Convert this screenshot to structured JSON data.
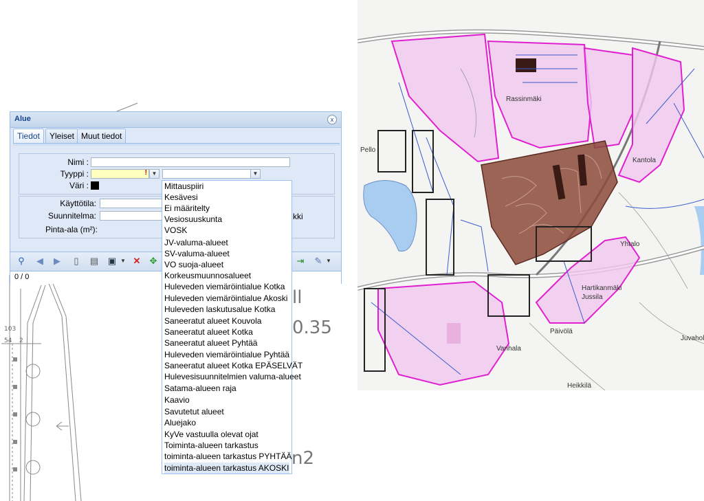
{
  "panel": {
    "title": "Alue",
    "close_glyph": "x",
    "tabs": [
      "Tiedot",
      "Yleiset",
      "Muut tiedot"
    ],
    "active_tab": "Tiedot",
    "fields": {
      "nimi_label": "Nimi :",
      "nimi_value": "",
      "tyyppi_label": "Tyyppi :",
      "tyyppi_value": "",
      "tyyppi_warning": "!",
      "subtype_value": "",
      "vari_label": "Väri :",
      "vari_color": "#000000",
      "kayttotila_label": "Käyttötila:",
      "suunnitelma_label": "Suunnitelma:",
      "suunnitelma_suffix": "kki",
      "pinta_ala_label": "Pinta-ala (m²):"
    },
    "toolbar_icons": [
      "search-icon",
      "prev-icon",
      "next-icon",
      "new-document-icon",
      "table-icon",
      "save-icon",
      "delete-icon",
      "move-icon",
      "export-icon",
      "tools-icon"
    ],
    "status_text": "0 / 0"
  },
  "dropdown": {
    "options": [
      "Mittauspiiri",
      "Kesävesi",
      "Ei määritelty",
      "Vesiosuuskunta",
      "VOSK",
      "JV-valuma-alueet",
      "SV-valuma-alueet",
      "VO suoja-alueet",
      "Korkeusmuunnosalueet",
      "Huleveden viemäröintialue Kotka",
      "Huleveden viemäröintialue Akoski",
      "Huleveden laskutusalue Kotka",
      "Saneeratut alueet Kouvola",
      "Saneeratut alueet Kotka",
      "Saneeratut alueet Pyhtää",
      "Huleveden viemäröintialue Pyhtää",
      "Saneeratut alueet Kotka EPÄSELVÄT",
      "Hulevesisuunnitelmien valuma-alueet",
      "Satama-alueen raja",
      "Kaavio",
      "Savutetut alueet",
      "Aluejako",
      "KyVe vastuulla olevat ojat",
      "Toiminta-alueen tarkastus",
      "toiminta-alueen tarkastus PYHTÄÄ",
      "toiminta-alueen tarkastus AKOSKI"
    ],
    "selected": "toiminta-alueen tarkastus AKOSKI"
  },
  "cad": {
    "text_ll": "ll",
    "text_035": "0.35",
    "text_n2": "n2",
    "text_103": "103",
    "text_54": "54",
    "text_2": "2"
  },
  "map": {
    "labels": [
      "Rassinmäki",
      "Kantola",
      "Yhtalo",
      "Hartikanmäki",
      "Jussila",
      "Päivölä",
      "Juvahol",
      "Vanhala",
      "Heikkilä",
      "Pello"
    ],
    "colors": {
      "pink_fill": "#f0c8ee",
      "pink_stroke": "#e020d0",
      "brown_fill": "#8b4a3a",
      "blue_line": "#3a5bd0",
      "water": "#a9cdf0"
    }
  }
}
